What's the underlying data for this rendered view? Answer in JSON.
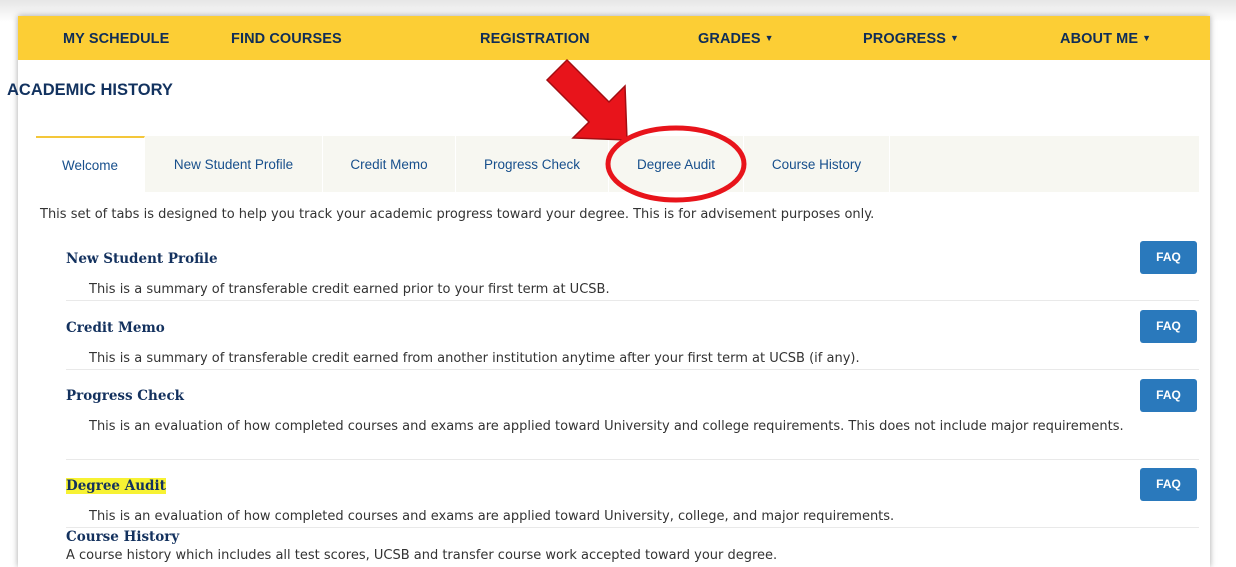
{
  "nav": {
    "items": [
      {
        "label": "MY SCHEDULE",
        "caret": false
      },
      {
        "label": "FIND COURSES",
        "caret": false
      },
      {
        "label": "REGISTRATION",
        "caret": false
      },
      {
        "label": "GRADES",
        "caret": true
      },
      {
        "label": "PROGRESS",
        "caret": true
      },
      {
        "label": "ABOUT ME",
        "caret": true
      }
    ]
  },
  "page_title": "ACADEMIC HISTORY",
  "tabs": [
    {
      "label": "Welcome",
      "active": true
    },
    {
      "label": "New Student Profile",
      "active": false
    },
    {
      "label": "Credit Memo",
      "active": false
    },
    {
      "label": "Progress Check",
      "active": false
    },
    {
      "label": "Degree Audit",
      "active": false,
      "circled": true
    },
    {
      "label": "Course History",
      "active": false
    }
  ],
  "intro": "This set of tabs is designed to help you track your academic progress toward your degree. This is for advisement purposes only.",
  "sections": [
    {
      "title": "New Student Profile",
      "desc": "This is a summary of transferable credit earned prior to your first term at UCSB.",
      "faq": "FAQ"
    },
    {
      "title": "Credit Memo",
      "desc": "This is a summary of transferable credit earned from another institution anytime after your first term at UCSB (if any).",
      "faq": "FAQ"
    },
    {
      "title": "Progress Check",
      "desc": "This is an evaluation of how completed courses and exams are applied toward University and college requirements. This does not include major requirements.",
      "faq": "FAQ"
    },
    {
      "title": "Degree Audit",
      "desc": "This is an evaluation of how completed courses and exams are applied toward University, college, and major requirements.",
      "faq": "FAQ",
      "highlighted": true
    },
    {
      "title": "Course History",
      "desc": "A course history which includes all test scores, UCSB and transfer course work accepted toward your degree."
    }
  ],
  "colors": {
    "nav_bg": "#fcce35",
    "nav_text": "#0f2d57",
    "faq_button": "#2a79bc",
    "annotation_red": "#e8141b",
    "highlight": "#f7f233"
  },
  "icons": {
    "caret": "caret-down-icon",
    "annotation_arrow": "red-arrow-icon",
    "annotation_circle": "red-circle-icon"
  }
}
